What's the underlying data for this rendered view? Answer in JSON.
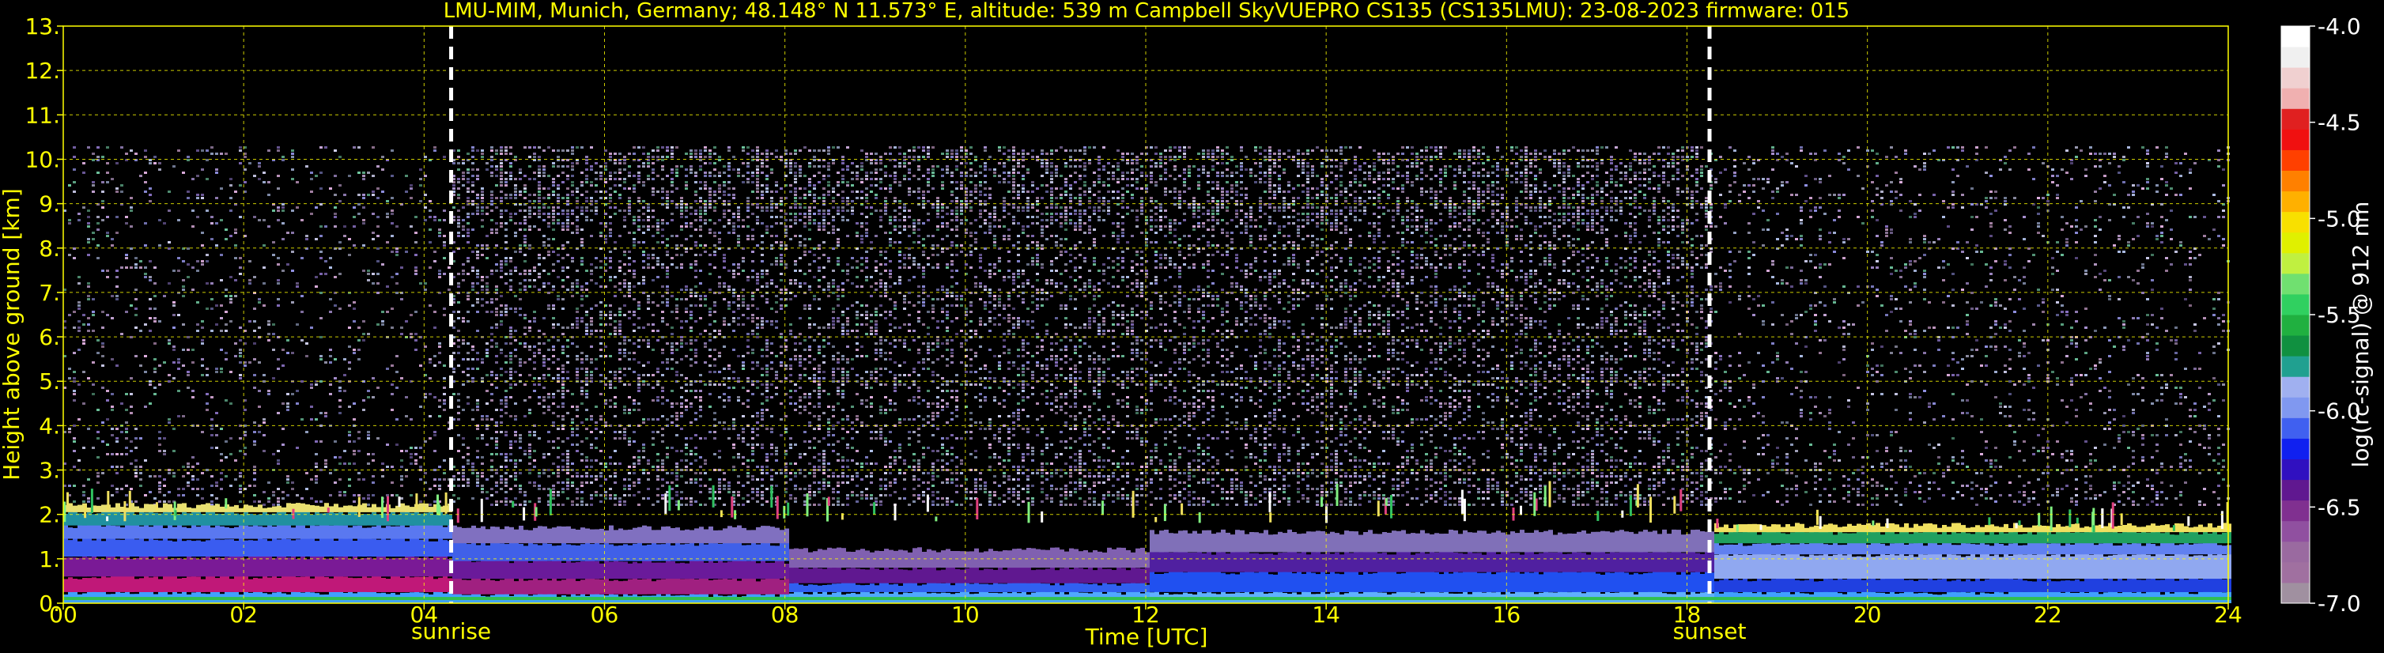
{
  "chart_data": {
    "type": "heatmap",
    "title": "LMU-MIM, Munich, Germany; 48.148° N 11.573° E, altitude: 539 m    Campbell SkyVUEPRO CS135 (CS135LMU): 23-08-2023    firmware: 015",
    "xlabel": "Time [UTC]",
    "ylabel": "Height above ground [km]",
    "xlim": [
      0,
      24
    ],
    "ylim": [
      0,
      13
    ],
    "x_ticks": [
      "00",
      "02",
      "04",
      "06",
      "08",
      "10",
      "12",
      "14",
      "16",
      "18",
      "20",
      "22",
      "24"
    ],
    "y_ticks": [
      "0.",
      "1.",
      "2.",
      "3.",
      "4.",
      "5.",
      "6.",
      "7.",
      "8.",
      "9.",
      "10.",
      "11.",
      "12.",
      "13."
    ],
    "grid": true,
    "grid_color": "#ffff00",
    "text_color": "#ffff00",
    "background": "#000000",
    "signal_top_km": 10.3,
    "markers": [
      {
        "label": "sunrise",
        "time_utc": 4.3
      },
      {
        "label": "sunset",
        "time_utc": 18.25
      }
    ],
    "colorbar": {
      "label": "log(rc-signal) @ 912 nm",
      "range": [
        -7.0,
        -4.0
      ],
      "ticks": [
        "-4.0",
        "-4.5",
        "-5.0",
        "-5.5",
        "-6.0",
        "-6.5",
        "-7.0"
      ],
      "colors": [
        "#a090a0",
        "#a070a0",
        "#9a6aa0",
        "#9050a0",
        "#803090",
        "#601890",
        "#3010c0",
        "#1020f0",
        "#4060f0",
        "#8098f0",
        "#a0b0f0",
        "#20a090",
        "#109040",
        "#20b040",
        "#30d060",
        "#70e070",
        "#c0f040",
        "#e0f000",
        "#f8e000",
        "#ffb000",
        "#ff8000",
        "#ff4000",
        "#f01010",
        "#e02020",
        "#f0b0b0",
        "#f0d0d0",
        "#f0f0f0",
        "#ffffff"
      ]
    }
  }
}
